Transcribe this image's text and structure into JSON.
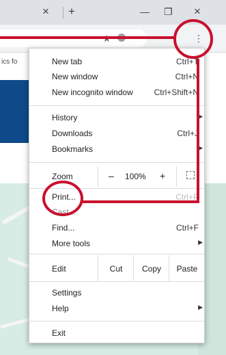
{
  "titlebar": {
    "close_tab_glyph": "×",
    "new_tab_glyph": "+",
    "minimize_glyph": "—",
    "restore_glyph": "❐",
    "close_window_glyph": "×"
  },
  "addressbar": {
    "star_glyph": "★",
    "menu_glyph": "⋮"
  },
  "page": {
    "partial_text": "ics fo"
  },
  "menu": {
    "new_tab": "New tab",
    "new_tab_shortcut": "Ctrl+T",
    "new_window": "New window",
    "new_window_shortcut": "Ctrl+N",
    "new_incognito": "New incognito window",
    "new_incognito_shortcut": "Ctrl+Shift+N",
    "history": "History",
    "downloads": "Downloads",
    "downloads_shortcut": "Ctrl+J",
    "bookmarks": "Bookmarks",
    "zoom_label": "Zoom",
    "zoom_minus": "–",
    "zoom_value": "100%",
    "zoom_plus": "+",
    "print": "Print...",
    "print_shortcut": "Ctrl+P",
    "cast": "Cast...",
    "find": "Find...",
    "find_shortcut": "Ctrl+F",
    "more_tools": "More tools",
    "edit_label": "Edit",
    "cut": "Cut",
    "copy": "Copy",
    "paste": "Paste",
    "settings": "Settings",
    "help": "Help",
    "exit": "Exit",
    "submenu_arrow": "▶"
  },
  "colors": {
    "annotation_red": "#c8102e",
    "page_blue": "#0f4a8a",
    "map_green": "#d6ece5"
  }
}
